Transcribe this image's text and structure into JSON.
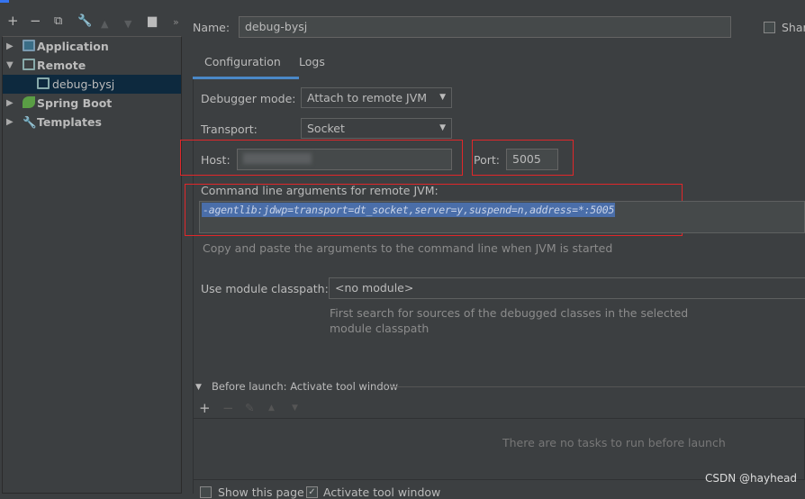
{
  "toolbar": {
    "add": "+",
    "remove": "−",
    "more": "»"
  },
  "tree": [
    {
      "label": "Application",
      "expanded": false
    },
    {
      "label": "Remote",
      "expanded": true
    },
    {
      "label": "debug-bysj",
      "selected": true
    },
    {
      "label": "Spring Boot",
      "expanded": false
    },
    {
      "label": "Templates",
      "expanded": false
    }
  ],
  "name": {
    "label": "Name:",
    "value": "debug-bysj",
    "share": "Shar"
  },
  "tabs": [
    {
      "label": "Configuration",
      "active": true
    },
    {
      "label": "Logs"
    }
  ],
  "debugger_mode": {
    "label": "Debugger mode:",
    "value": "Attach to remote JVM"
  },
  "transport": {
    "label": "Transport:",
    "value": "Socket"
  },
  "host": {
    "label": "Host:",
    "value": ""
  },
  "port": {
    "label": "Port:",
    "value": "5005"
  },
  "cmd": {
    "label": "Command line arguments for remote JVM:",
    "value": "-agentlib:jdwp=transport=dt_socket,server=y,suspend=n,address=*:5005",
    "hint": "Copy and paste the arguments to the command line when JVM is started"
  },
  "module": {
    "label": "Use module classpath:",
    "value": "<no module>",
    "hint1": "First search for sources of the debugged classes in the selected",
    "hint2": "module classpath"
  },
  "before_launch": {
    "title": "Before launch: Activate tool window",
    "empty": "There are no tasks to run before launch",
    "show_page": "Show this page",
    "activate": "Activate tool window"
  },
  "watermark": "CSDN @hayhead"
}
